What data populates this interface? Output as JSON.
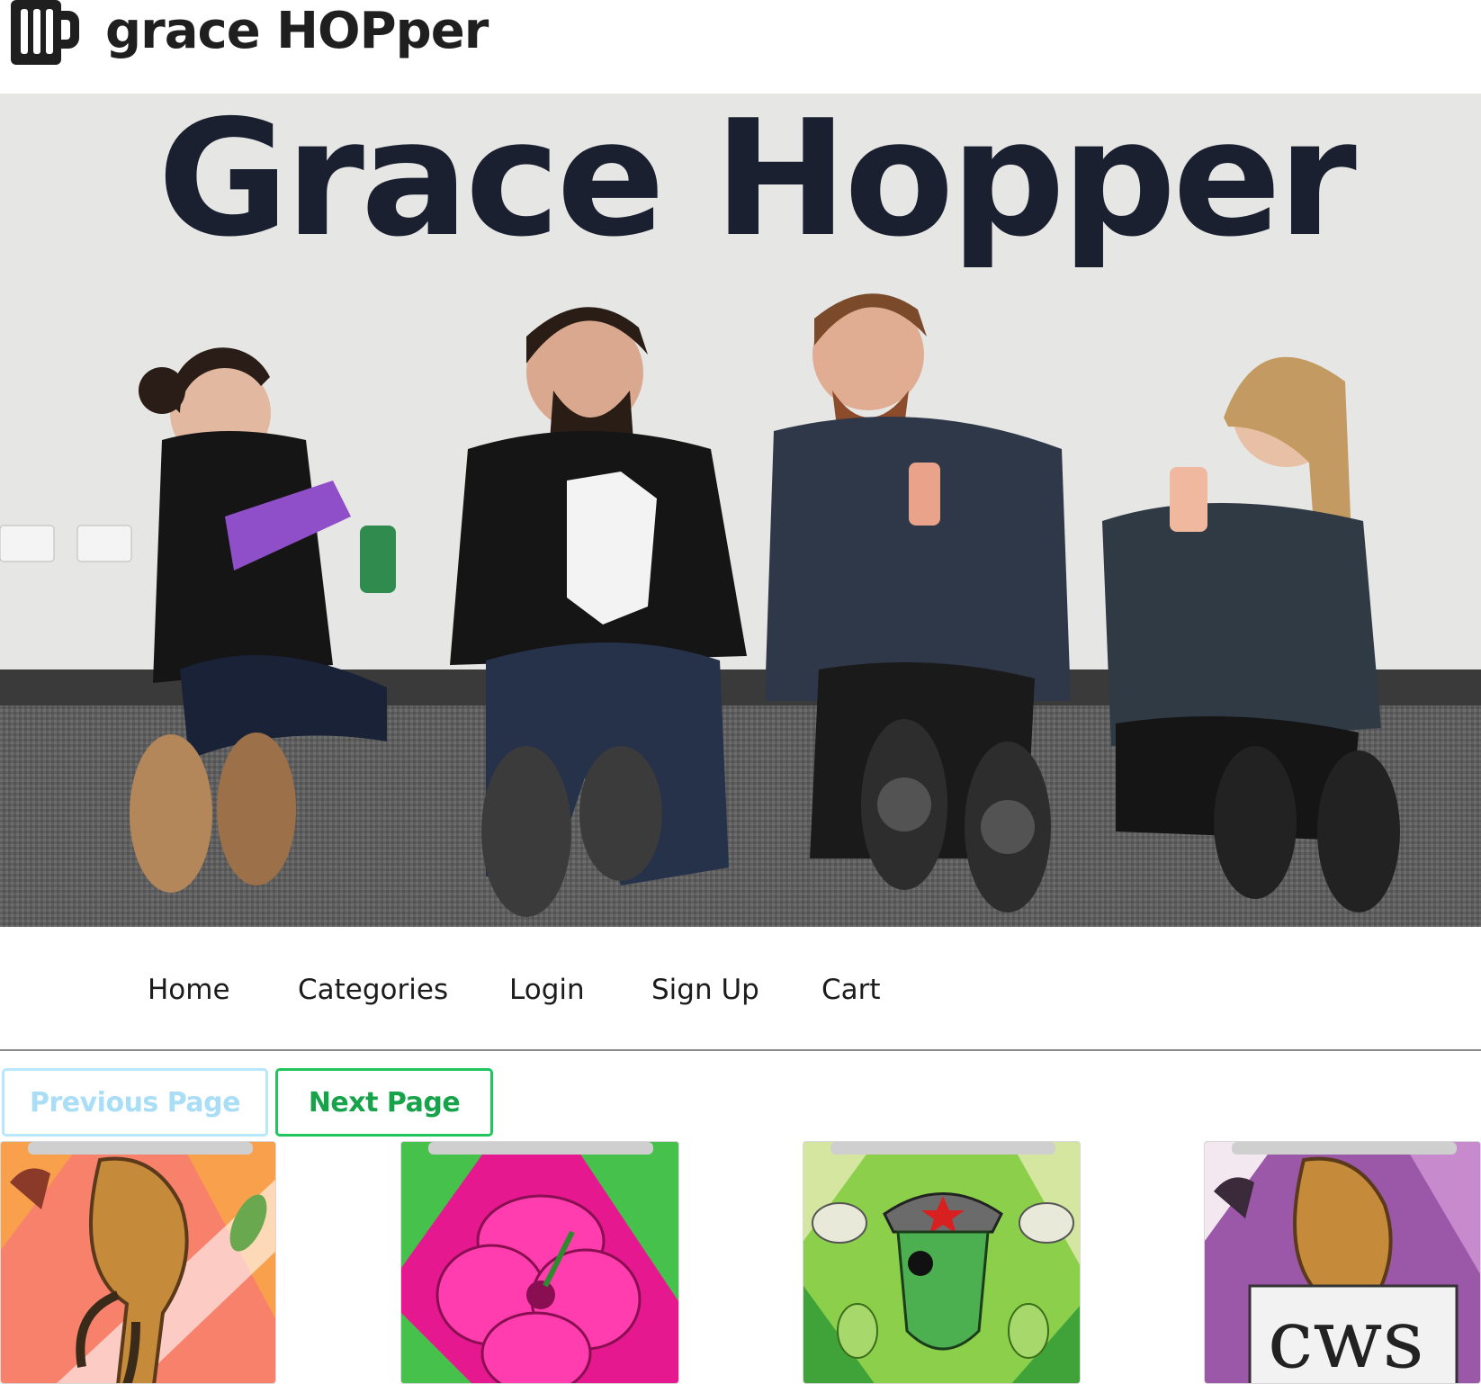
{
  "header": {
    "brand": "grace HOPper",
    "logo_icon": "beer-mug-icon"
  },
  "hero": {
    "headline": "Grace Hopper",
    "image_alt": "Four people sitting against a wall laughing and holding beer cans"
  },
  "nav": {
    "items": [
      {
        "label": "Home"
      },
      {
        "label": "Categories"
      },
      {
        "label": "Login"
      },
      {
        "label": "Sign Up"
      },
      {
        "label": "Cart"
      }
    ]
  },
  "pagination": {
    "previous_label": "Previous Page",
    "next_label": "Next Page",
    "previous_enabled": false,
    "next_enabled": true
  },
  "products": [
    {
      "art": "eagle-talon-orange-can",
      "colors": [
        "#f7816b",
        "#f9a04d"
      ]
    },
    {
      "art": "hibiscus-pink-green-can",
      "colors": [
        "#e6188f",
        "#46c14b"
      ]
    },
    {
      "art": "soldier-hop-green-can",
      "colors": [
        "#8ccf4b",
        "#d4e6a0"
      ]
    },
    {
      "art": "eagle-talon-purple-can",
      "colors": [
        "#9b57a8",
        "#f3e7f0"
      ]
    }
  ]
}
